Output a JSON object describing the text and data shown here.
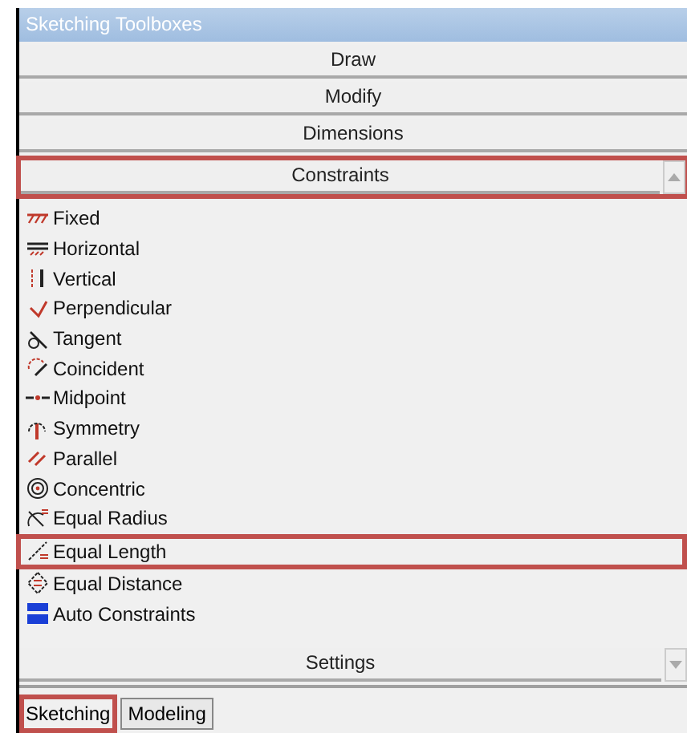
{
  "window": {
    "title": "Sketching Toolboxes"
  },
  "sections_top": [
    {
      "label": "Draw",
      "highlighted": false
    },
    {
      "label": "Modify",
      "highlighted": false
    },
    {
      "label": "Dimensions",
      "highlighted": false
    },
    {
      "label": "Constraints",
      "highlighted": true
    }
  ],
  "items": [
    {
      "label": "Fixed",
      "highlighted": false
    },
    {
      "label": "Horizontal",
      "highlighted": false
    },
    {
      "label": "Vertical",
      "highlighted": false
    },
    {
      "label": "Perpendicular",
      "highlighted": false
    },
    {
      "label": "Tangent",
      "highlighted": false
    },
    {
      "label": "Coincident",
      "highlighted": false
    },
    {
      "label": "Midpoint",
      "highlighted": false
    },
    {
      "label": "Symmetry",
      "highlighted": false
    },
    {
      "label": "Parallel",
      "highlighted": false
    },
    {
      "label": "Concentric",
      "highlighted": false
    },
    {
      "label": "Equal Radius",
      "highlighted": false
    },
    {
      "label": "Equal Length",
      "highlighted": true
    },
    {
      "label": "Equal Distance",
      "highlighted": false
    },
    {
      "label": "Auto Constraints",
      "highlighted": false
    }
  ],
  "sections_bottom": [
    {
      "label": "Settings",
      "highlighted": false
    }
  ],
  "tabs": [
    {
      "label": "Sketching",
      "selected": true,
      "highlighted": true
    },
    {
      "label": "Modeling",
      "selected": false,
      "highlighted": false
    }
  ]
}
